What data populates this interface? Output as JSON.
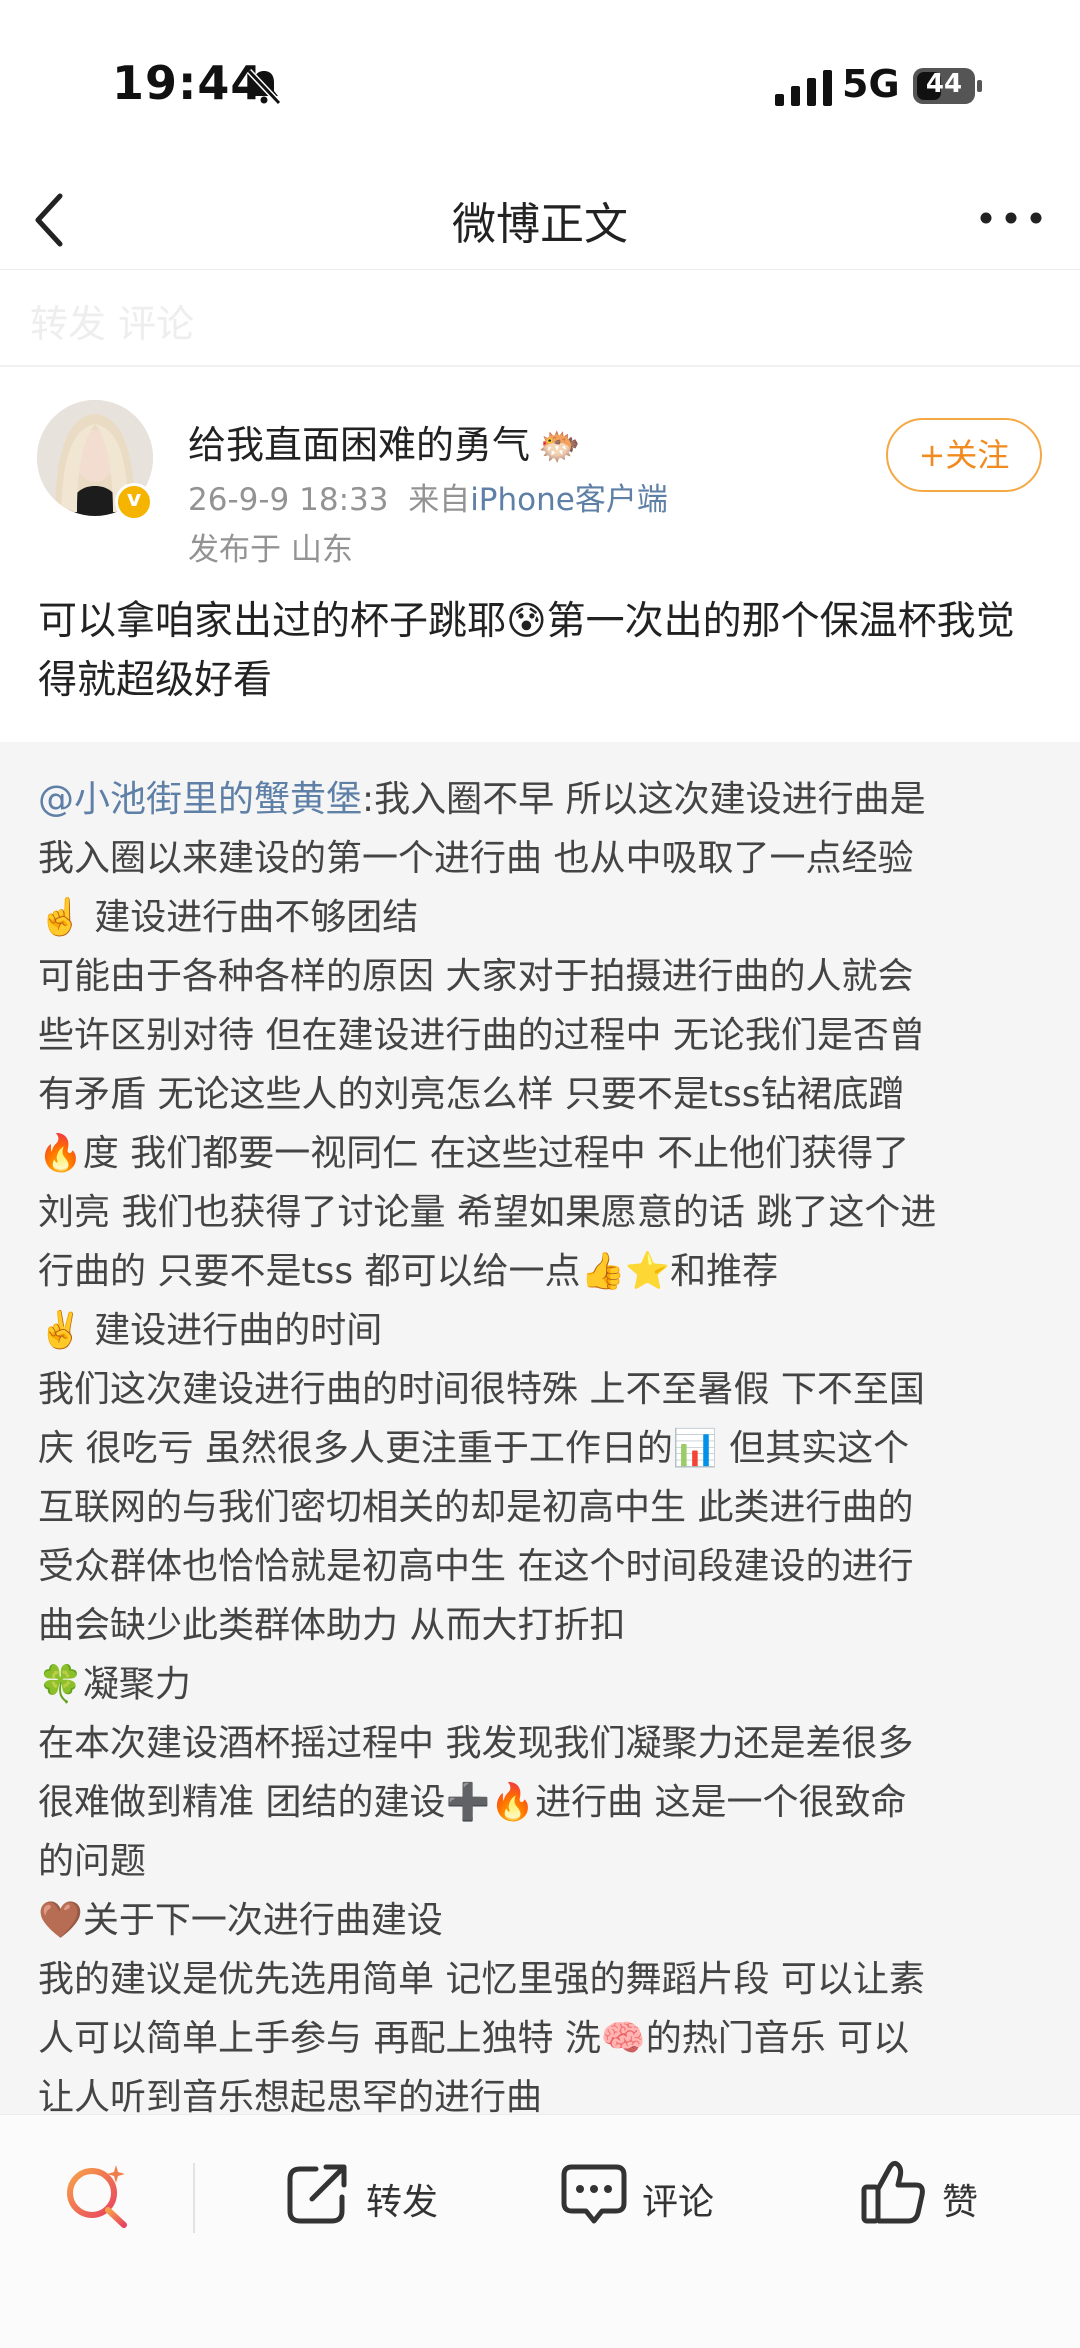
{
  "status_bar": {
    "time": "19:44",
    "network": "5G",
    "battery": "44",
    "battery_level": 0.44
  },
  "nav": {
    "title": "微博正文"
  },
  "faint_text": "转发 评论",
  "post": {
    "author": {
      "name": "给我直面困难的勇气",
      "name_emoji": "🐡"
    },
    "time": "26-9-9 18:33",
    "source_prefix": "来自",
    "source": "iPhone客户端",
    "location": "发布于 山东",
    "follow_label": "+关注",
    "text": "可以拿咱家出过的杯子跳耶😰第一次出的那个保温杯我觉得就超级好看"
  },
  "quote": {
    "author": "@小池街里的蟹黄堡",
    "lines": [
      ":我入圈不早 所以这次建设进行曲是",
      "我入圈以来建设的第一个进行曲 也从中吸取了一点经验",
      "☝️ 建设进行曲不够团结",
      "可能由于各种各样的原因 大家对于拍摄进行曲的人就会",
      "些许区别对待 但在建设进行曲的过程中 无论我们是否曾",
      "有矛盾 无论这些人的刘亮怎么样 只要不是tss钻裙底蹭",
      "🔥度 我们都要一视同仁 在这些过程中 不止他们获得了",
      "刘亮 我们也获得了讨论量 希望如果愿意的话 跳了这个进",
      "行曲的 只要不是tss 都可以给一点👍⭐和推荐",
      "✌️ 建设进行曲的时间",
      "我们这次建设进行曲的时间很特殊 上不至暑假 下不至国",
      "庆 很吃亏 虽然很多人更注重于工作日的📊 但其实这个",
      "互联网的与我们密切相关的却是初高中生 此类进行曲的",
      "受众群体也恰恰就是初高中生 在这个时间段建设的进行",
      "曲会缺少此类群体助力 从而大打折扣",
      "🍀凝聚力",
      "在本次建设酒杯摇过程中 我发现我们凝聚力还是差很多",
      "很难做到精准 团结的建设➕🔥进行曲 这是一个很致命",
      "的问题",
      "🤎关于下一次进行曲建设",
      "我的建议是优先选用简单 记忆里强的舞蹈片段 可以让素",
      "人可以简单上手参与 再配上独特 洗🧠的热门音乐 可以",
      "让人听到音乐想起思罕的进行曲"
    ]
  },
  "bottom_bar": {
    "repost": "转发",
    "comment": "评论",
    "like": "赞"
  }
}
